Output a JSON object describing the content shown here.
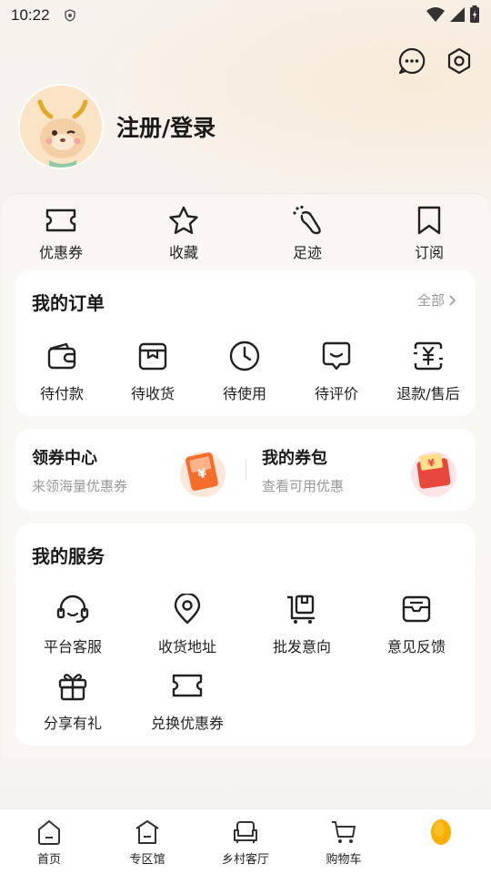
{
  "status_bar": {
    "time": "10:22"
  },
  "profile": {
    "login_text": "注册/登录"
  },
  "quick_links": [
    {
      "label": "优惠券",
      "icon": "ticket-icon"
    },
    {
      "label": "收藏",
      "icon": "star-icon"
    },
    {
      "label": "足迹",
      "icon": "footprint-icon"
    },
    {
      "label": "订阅",
      "icon": "bookmark-icon"
    }
  ],
  "orders": {
    "title": "我的订单",
    "more": "全部",
    "items": [
      {
        "label": "待付款",
        "icon": "wallet-icon"
      },
      {
        "label": "待收货",
        "icon": "package-icon"
      },
      {
        "label": "待使用",
        "icon": "clock-icon"
      },
      {
        "label": "待评价",
        "icon": "comment-icon"
      },
      {
        "label": "退款/售后",
        "icon": "refund-icon"
      }
    ]
  },
  "coupon_center": {
    "title": "领券中心",
    "subtitle": "来领海量优惠券",
    "badge": "¥"
  },
  "my_coupons": {
    "title": "我的券包",
    "subtitle": "查看可用优惠",
    "badge": "¥"
  },
  "services": {
    "title": "我的服务",
    "items": [
      {
        "label": "平台客服",
        "icon": "headset-icon"
      },
      {
        "label": "收货地址",
        "icon": "location-icon"
      },
      {
        "label": "批发意向",
        "icon": "cart-box-icon"
      },
      {
        "label": "意见反馈",
        "icon": "inbox-icon"
      },
      {
        "label": "分享有礼",
        "icon": "gift-icon"
      },
      {
        "label": "兑换优惠券",
        "icon": "ticket-icon"
      }
    ]
  },
  "tabbar": [
    {
      "label": "首页",
      "icon": "home-icon"
    },
    {
      "label": "专区馆",
      "icon": "pavilion-icon"
    },
    {
      "label": "乡村客厅",
      "icon": "sofa-icon"
    },
    {
      "label": "购物车",
      "icon": "cart-icon"
    },
    {
      "label": "",
      "icon": "profile-active-icon"
    }
  ],
  "colors": {
    "accent": "#f7b000",
    "coupon_orange": "#f46d2b",
    "coupon_red": "#e7483b"
  }
}
